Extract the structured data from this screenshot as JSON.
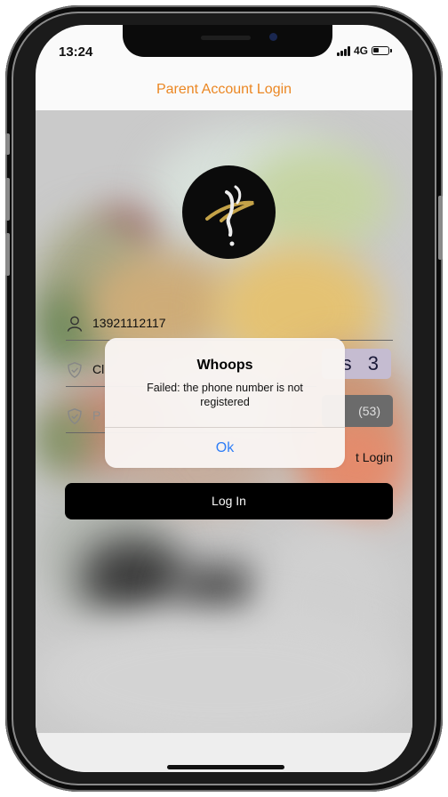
{
  "status_bar": {
    "time": "13:24",
    "network": "4G"
  },
  "nav": {
    "title": "Parent Account Login"
  },
  "form": {
    "phone_value": "13921112117",
    "code_placeholder_visible": "Cl",
    "password_placeholder_visible": "P",
    "captcha_text": "s 3",
    "get_code_countdown": "(53)",
    "code_login_link": "t Login",
    "login_button": "Log In"
  },
  "alert": {
    "title": "Whoops",
    "message": "Failed: the phone number is not registered",
    "ok_label": "Ok"
  },
  "colors": {
    "accent_orange": "#f08a24",
    "alert_link_blue": "#2f7ef6",
    "button_black": "#000000"
  },
  "icons": [
    "person-icon",
    "shield-check-icon",
    "cellular-signal-icon",
    "battery-icon"
  ]
}
